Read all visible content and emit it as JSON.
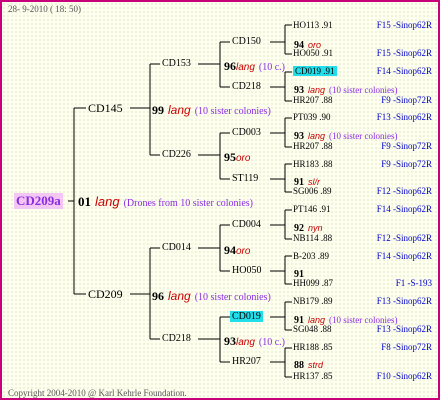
{
  "header": "28- 9-2010 ( 18: 50)",
  "footer": "Copyright 2004-2010 @ Karl Kehrle Foundation.",
  "root": {
    "id": "CD209a",
    "year": "01",
    "race": "lang",
    "note": "(Drones from 10 sister colonies)"
  },
  "gen1": [
    {
      "id": "CD145",
      "year": "99",
      "race": "lang",
      "note": "(10 sister colonies)"
    },
    {
      "id": "CD209",
      "year": "96",
      "race": "lang",
      "note": "(10 sister colonies)"
    }
  ],
  "gen2": [
    {
      "id": "CD153",
      "year": "96",
      "race": "lang",
      "note": "(10 c.)"
    },
    {
      "id": "CD226",
      "year": "95",
      "race": "oro",
      "note": ""
    },
    {
      "id": "CD014",
      "year": "94",
      "race": "oro",
      "note": ""
    },
    {
      "id": "CD218",
      "year": "93",
      "race": "lang",
      "note": "(10 c.)"
    }
  ],
  "gen3": [
    {
      "id": "CD150",
      "year": "94",
      "race": "oro",
      "note": ""
    },
    {
      "id": "CD218",
      "year": "93",
      "race": "lang",
      "note": "(10 sister colonies)"
    },
    {
      "id": "CD003",
      "year": "93",
      "race": "lang",
      "note": "(10 sister colonies)"
    },
    {
      "id": "ST119",
      "year": "91",
      "race": "sl/r",
      "note": ""
    },
    {
      "id": "CD004",
      "year": "92",
      "race": "nyn",
      "note": ""
    },
    {
      "id": "HO050",
      "year": "91",
      "race": "",
      "note": ""
    },
    {
      "id": "CD019",
      "year": "91",
      "race": "lang",
      "note": "(10 sister colonies)"
    },
    {
      "id": "HR207",
      "year": "88",
      "race": "strd",
      "note": ""
    }
  ],
  "gen4": [
    {
      "id": "HO113 .91",
      "ref": "F15 -Sinop62R",
      "hl": false
    },
    {
      "id": "HO050 .91",
      "ref": "F15 -Sinop62R",
      "hl": false
    },
    {
      "id": "CD019 .91",
      "ref": "F14 -Sinop62R",
      "hl": true
    },
    {
      "id": "HR207 .88",
      "ref": "F9 -Sinop72R",
      "hl": false
    },
    {
      "id": "PT039 .90",
      "ref": "F13 -Sinop62R",
      "hl": false
    },
    {
      "id": "HR207 .88",
      "ref": "F9 -Sinop72R",
      "hl": false
    },
    {
      "id": "HR183 .88",
      "ref": "F9 -Sinop72R",
      "hl": false
    },
    {
      "id": "SG006 .89",
      "ref": "F12 -Sinop62R",
      "hl": false
    },
    {
      "id": "PT146 .91",
      "ref": "F14 -Sinop62R",
      "hl": false
    },
    {
      "id": "NB114 .88",
      "ref": "F12 -Sinop62R",
      "hl": false
    },
    {
      "id": "B-203 .89",
      "ref": "F14 -Sinop62R",
      "hl": false
    },
    {
      "id": "HH099 .87",
      "ref": "F1 -S-193",
      "hl": false
    },
    {
      "id": "NB179 .89",
      "ref": "F13 -Sinop62R",
      "hl": false
    },
    {
      "id": "SG048 .88",
      "ref": "F13 -Sinop62R",
      "hl": false
    },
    {
      "id": "HR188 .85",
      "ref": "F8 -Sinop72R",
      "hl": false
    },
    {
      "id": "HR137 .85",
      "ref": "F10 -Sinop62R",
      "hl": false
    }
  ]
}
